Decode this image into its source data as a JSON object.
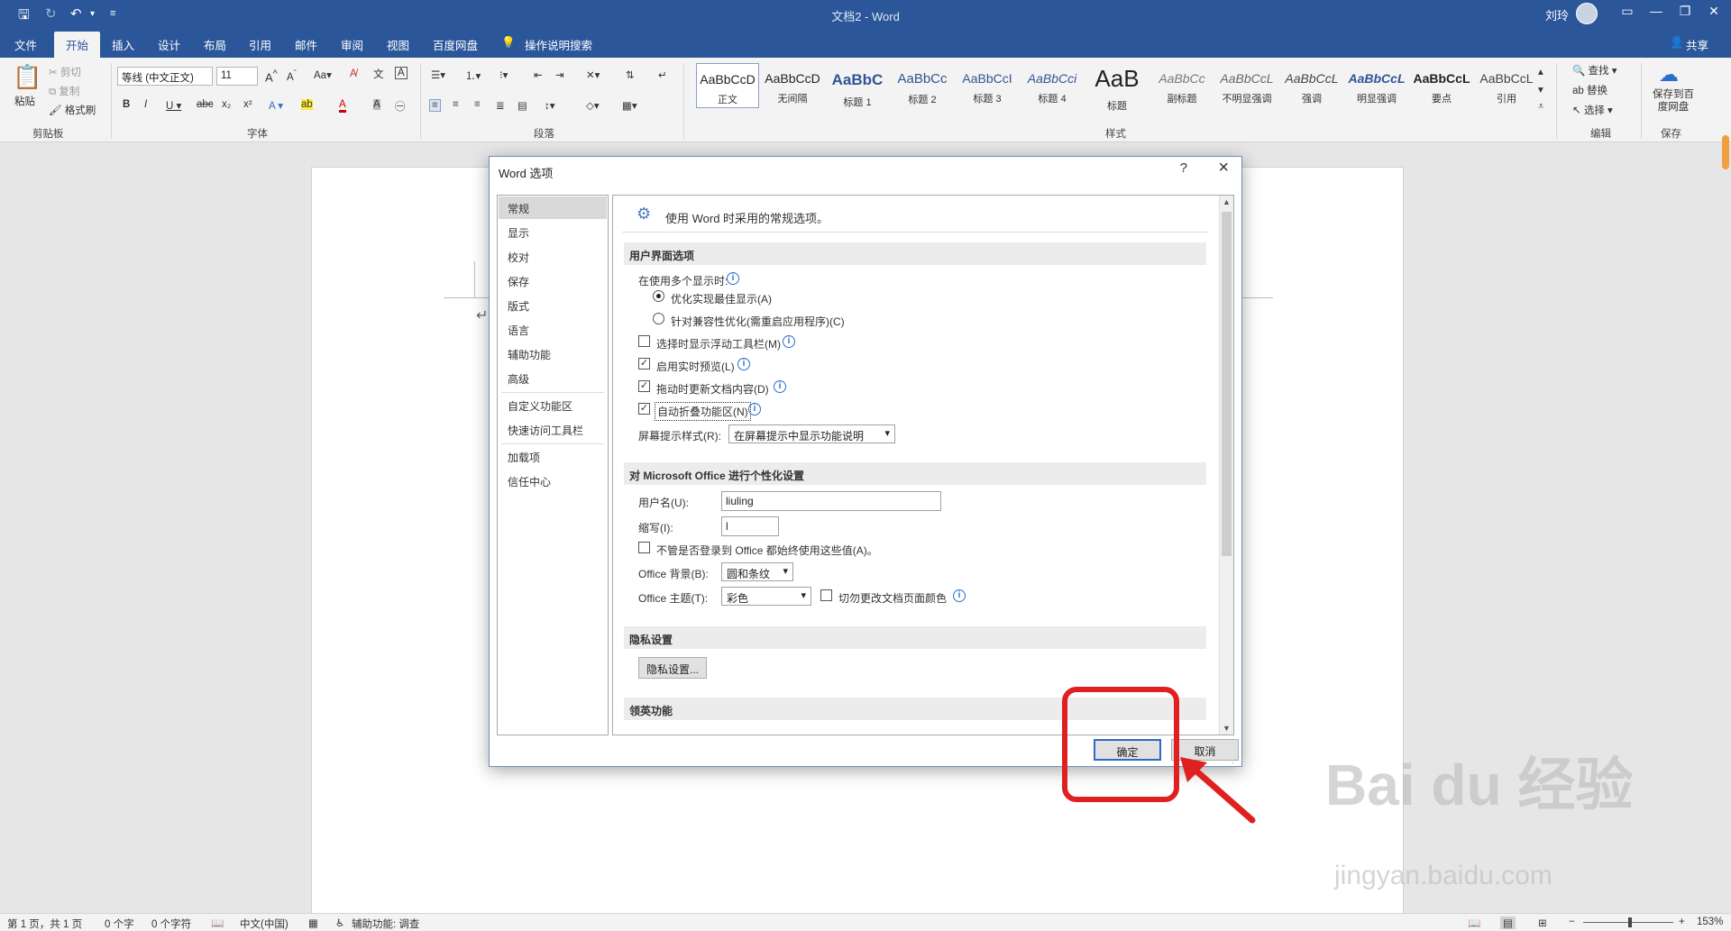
{
  "window": {
    "title": "文档2 - Word",
    "user": "刘玲"
  },
  "tabs": [
    "文件",
    "开始",
    "插入",
    "设计",
    "布局",
    "引用",
    "邮件",
    "审阅",
    "视图",
    "百度网盘"
  ],
  "active_tab": "开始",
  "tell_me": "操作说明搜索",
  "share": "共享",
  "ribbon": {
    "clipboard": {
      "label": "剪贴板",
      "paste": "粘贴",
      "cut": "剪切",
      "copy": "复制",
      "format_painter": "格式刷"
    },
    "font": {
      "label": "字体",
      "name": "等线 (中文正文)",
      "size": "11"
    },
    "paragraph": {
      "label": "段落"
    },
    "styles": {
      "label": "样式",
      "items": [
        {
          "sample": "AaBbCcD",
          "name": "正文"
        },
        {
          "sample": "AaBbCcD",
          "name": "无间隔"
        },
        {
          "sample": "AaBbC",
          "name": "标题 1"
        },
        {
          "sample": "AaBbCc",
          "name": "标题 2"
        },
        {
          "sample": "AaBbCcI",
          "name": "标题 3"
        },
        {
          "sample": "AaBbCci",
          "name": "标题 4"
        },
        {
          "sample": "AaB",
          "name": "标题"
        },
        {
          "sample": "AaBbCc",
          "name": "副标题"
        },
        {
          "sample": "AaBbCcL",
          "name": "不明显强调"
        },
        {
          "sample": "AaBbCcL",
          "name": "强调"
        },
        {
          "sample": "AaBbCcL",
          "name": "明显强调"
        },
        {
          "sample": "AaBbCcL",
          "name": "要点"
        },
        {
          "sample": "AaBbCcL",
          "name": "引用"
        }
      ]
    },
    "editing": {
      "label": "编辑",
      "find": "查找",
      "replace": "替换",
      "select": "选择"
    },
    "save": {
      "label": "保存",
      "button": "保存到百度网盘"
    }
  },
  "status": {
    "page": "第 1 页，共 1 页",
    "words": "0 个字",
    "chars": "0 个字符",
    "lang": "中文(中国)",
    "accessibility": "辅助功能: 调查",
    "zoom": "153%"
  },
  "dialog": {
    "title": "Word 选项",
    "help": "?",
    "nav": [
      "常规",
      "显示",
      "校对",
      "保存",
      "版式",
      "语言",
      "辅助功能",
      "高级",
      "自定义功能区",
      "快速访问工具栏",
      "加载项",
      "信任中心"
    ],
    "header_text": "使用 Word 时采用的常规选项。",
    "sections": {
      "ui": "用户界面选项",
      "personalize": "对 Microsoft Office 进行个性化设置",
      "privacy": "隐私设置",
      "linkedin": "领英功能"
    },
    "multi_display_label": "在使用多个显示时:",
    "radio_optimize": "优化实现最佳显示(A)",
    "radio_compat": "针对兼容性优化(需重启应用程序)(C)",
    "chk_mini_toolbar": "选择时显示浮动工具栏(M)",
    "chk_live_preview": "启用实时预览(L)",
    "chk_update_drag": "拖动时更新文档内容(D)",
    "chk_collapse_ribbon": "自动折叠功能区(N)",
    "screentip_label": "屏幕提示样式(R):",
    "screentip_value": "在屏幕提示中显示功能说明",
    "username_label": "用户名(U):",
    "username_value": "liuling",
    "initials_label": "缩写(I):",
    "initials_value": "l",
    "always_use_label": "不管是否登录到 Office 都始终使用这些值(A)。",
    "background_label": "Office 背景(B):",
    "background_value": "圆和条纹",
    "theme_label": "Office 主题(T):",
    "theme_value": "彩色",
    "never_change_label": "切勿更改文档页面颜色",
    "privacy_button": "隐私设置...",
    "ok": "确定",
    "cancel": "取消"
  },
  "watermark": {
    "brand": "Bai du 经验",
    "url": "jingyan.baidu.com"
  }
}
